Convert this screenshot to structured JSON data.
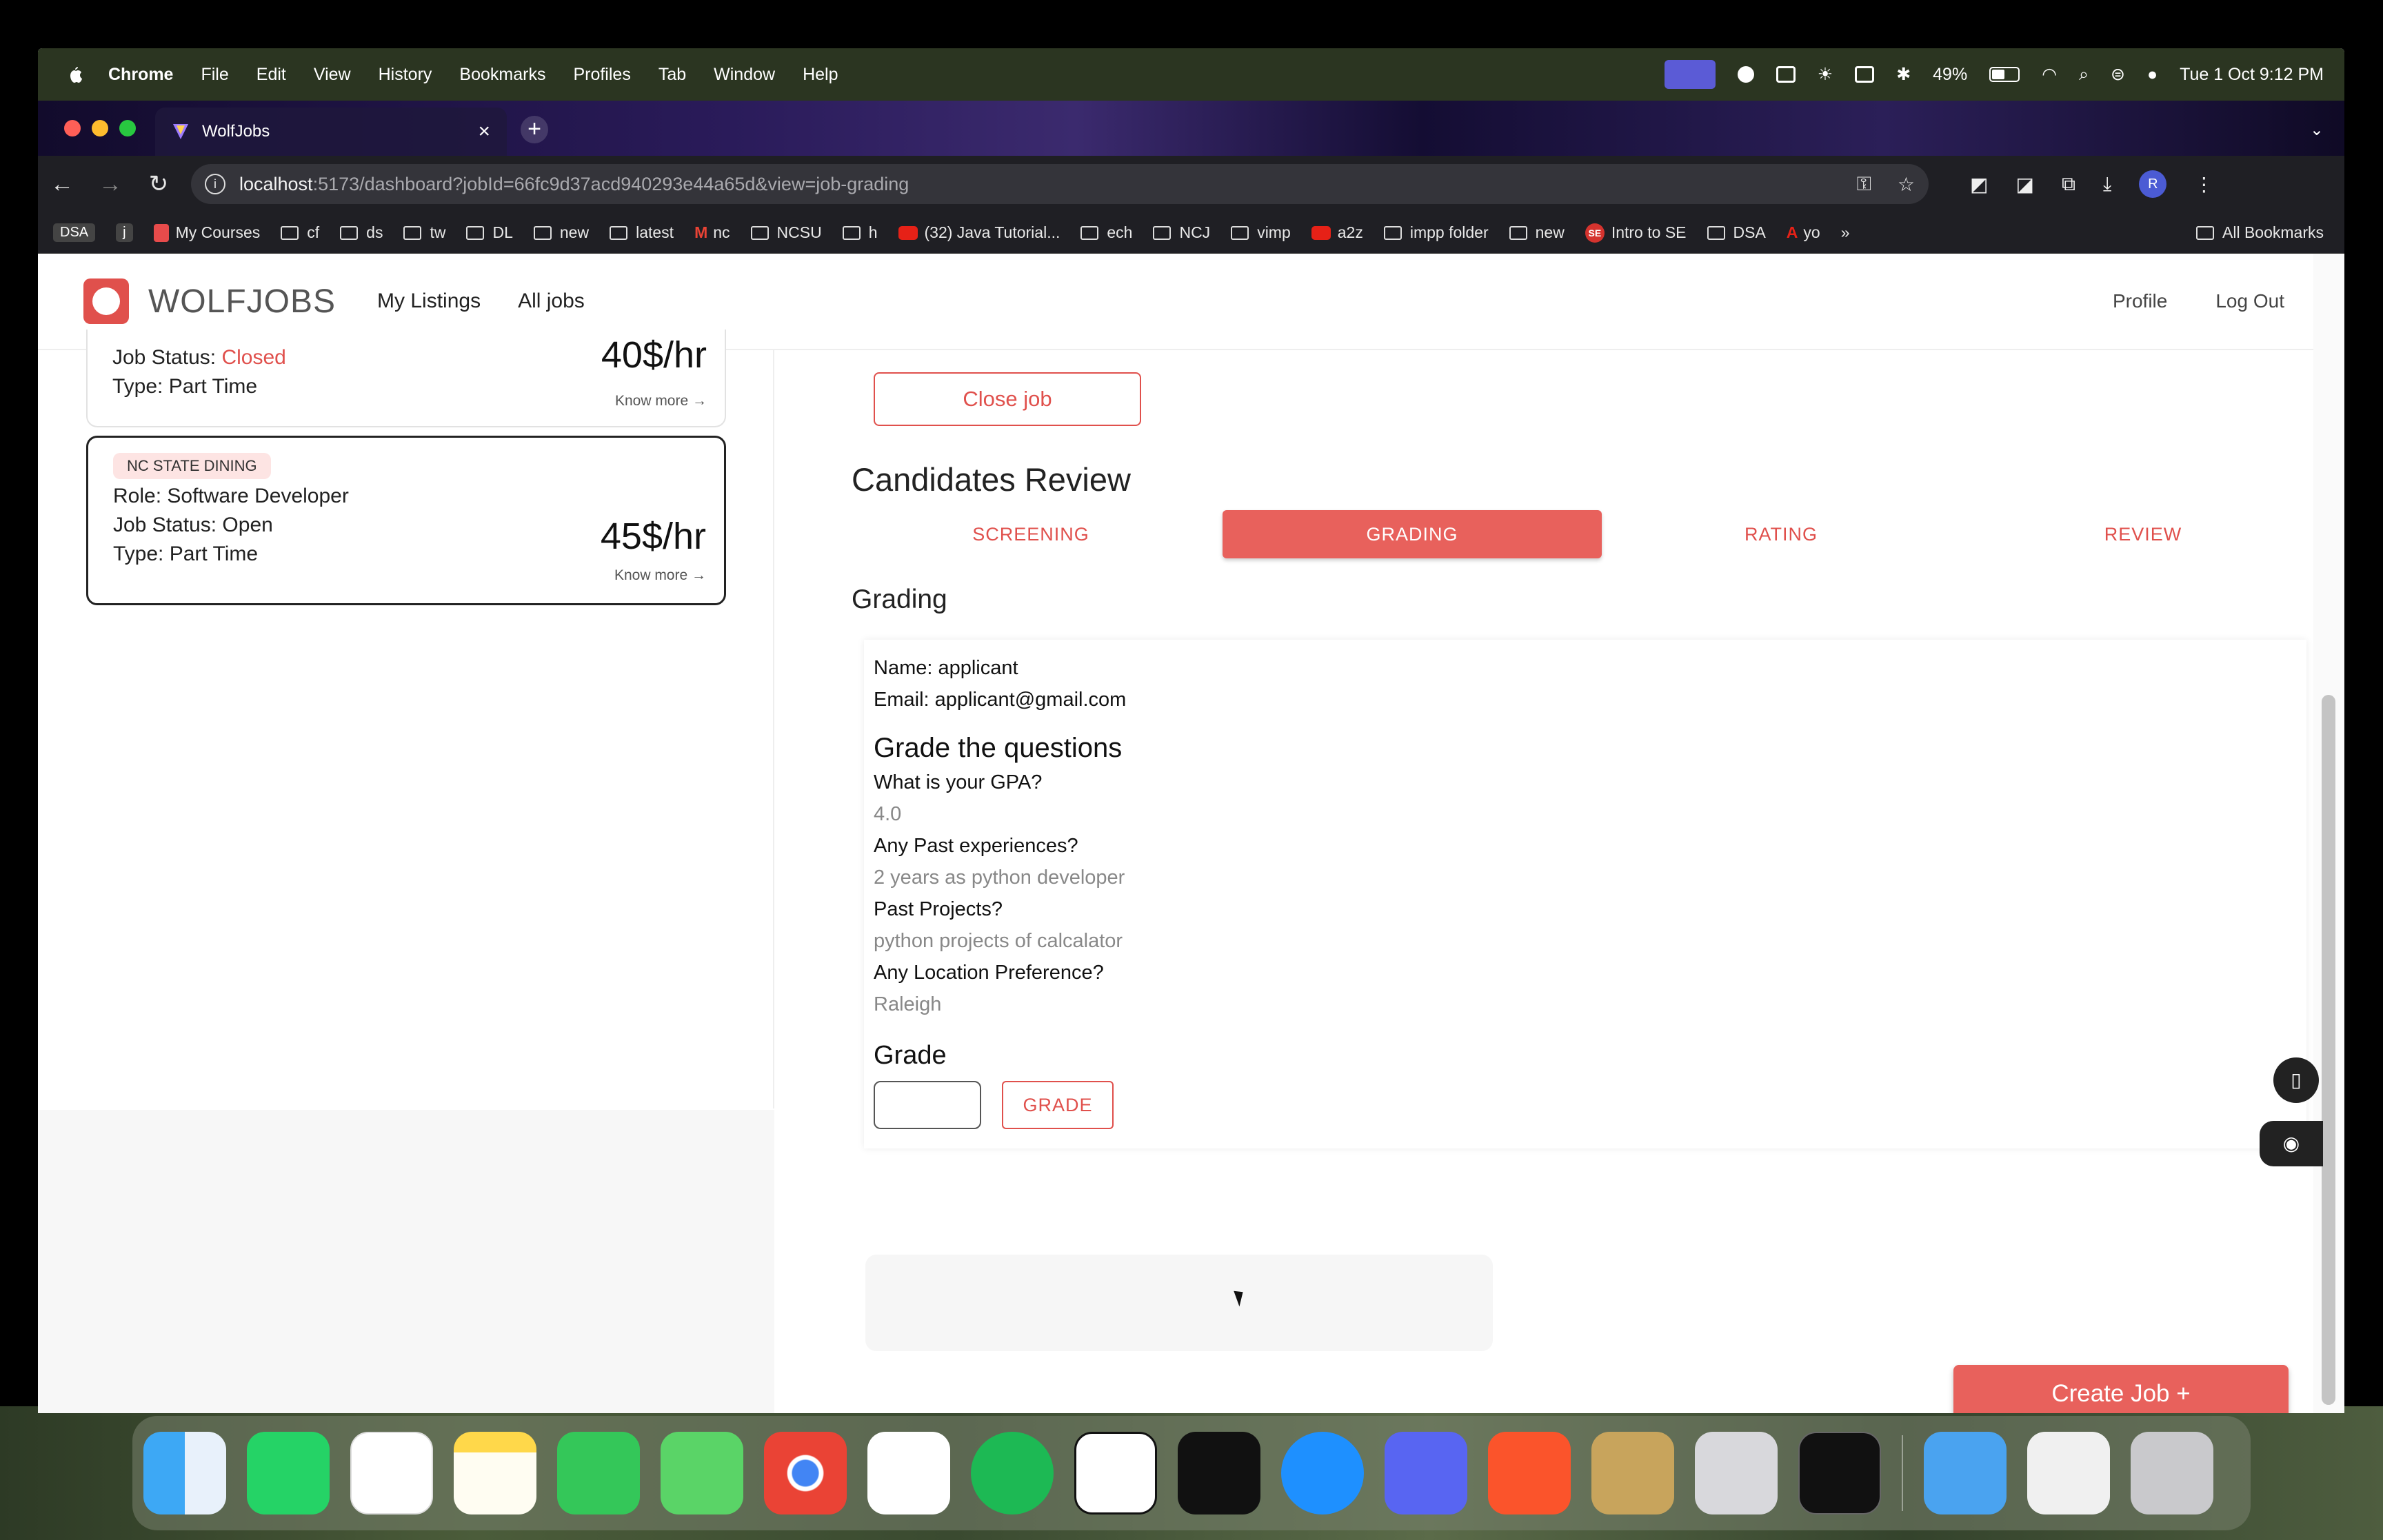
{
  "menubar": {
    "app_name": "Chrome",
    "items": [
      "File",
      "Edit",
      "View",
      "History",
      "Bookmarks",
      "Profiles",
      "Tab",
      "Window",
      "Help"
    ],
    "battery": "49%",
    "datetime": "Tue 1 Oct  9:12 PM"
  },
  "browser": {
    "tab_title": "WolfJobs",
    "url_host": "localhost",
    "url_path": ":5173/dashboard?jobId=66fc9d37acd940293e44a65d&view=job-grading",
    "profile_initial": "R",
    "bookmarks": {
      "dsa_badge": "DSA",
      "j_badge": "j",
      "items": [
        "My Courses",
        "cf",
        "ds",
        "tw",
        "DL",
        "new",
        "latest",
        "nc",
        "NCSU",
        "h",
        "(32) Java Tutorial...",
        "ech",
        "NCJ",
        "vimp",
        "a2z",
        "impp folder",
        "new",
        "Intro to SE",
        "DSA",
        "yo"
      ],
      "se_badge": "SE",
      "more": "»",
      "all": "All Bookmarks"
    }
  },
  "navbar": {
    "brand": "WOLFJOBS",
    "links": [
      "My Listings",
      "All jobs"
    ],
    "right_links": [
      "Profile",
      "Log Out"
    ]
  },
  "job_cards": [
    {
      "status_label": "Job Status: ",
      "status_value": "Closed",
      "type": "Type: Part Time",
      "pay": "40$/hr",
      "know_more": "Know more →"
    },
    {
      "company": "NC STATE DINING",
      "role": "Role: Software Developer",
      "status": "Job Status: Open",
      "type": "Type: Part Time",
      "pay": "45$/hr",
      "know_more": "Know more →"
    }
  ],
  "main": {
    "close_job": "Close job",
    "candidates_title": "Candidates Review",
    "tabs": [
      "SCREENING",
      "GRADING",
      "RATING",
      "REVIEW"
    ],
    "active_tab": "GRADING",
    "section_title": "Grading",
    "applicant": {
      "name": "Name: applicant",
      "email": "Email: applicant@gmail.com"
    },
    "questions_title": "Grade the questions",
    "questions": [
      {
        "q": "What is your GPA?",
        "a": "4.0"
      },
      {
        "q": "Any Past experiences?",
        "a": "2 years as python developer"
      },
      {
        "q": "Past Projects?",
        "a": "python projects of calcalator"
      },
      {
        "q": "Any Location Preference?",
        "a": "Raleigh"
      }
    ],
    "grade_title": "Grade",
    "grade_input_value": "",
    "grade_button": "GRADE",
    "create_job": "Create Job +"
  },
  "colors": {
    "accent": "#e8615c",
    "accent_dark": "#e0504c",
    "company_badge_bg": "#fde4e3"
  }
}
